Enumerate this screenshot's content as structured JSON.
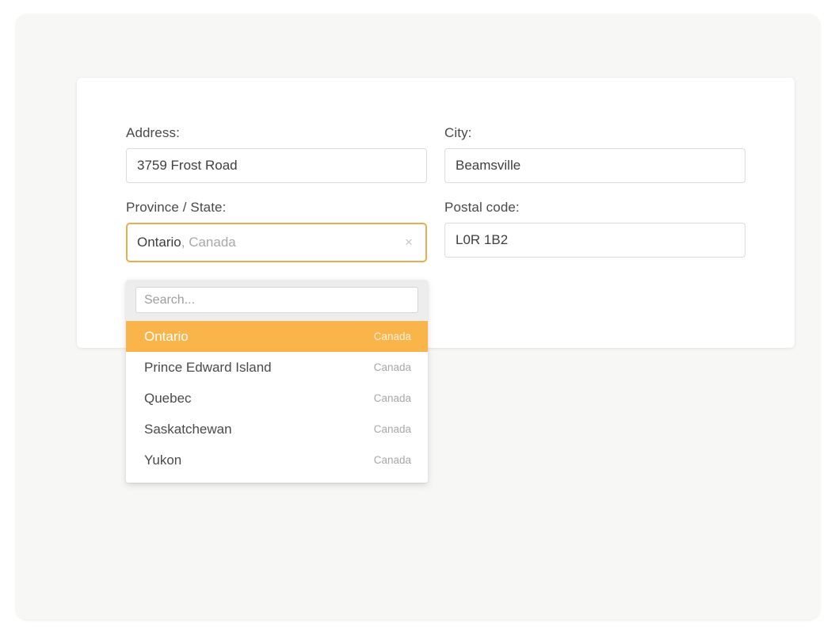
{
  "form": {
    "fields": [
      {
        "label": "Address:",
        "value": "3759 Frost Road",
        "name": "address"
      },
      {
        "label": "City:",
        "value": "Beamsville",
        "name": "city"
      },
      {
        "label": "Province / State:",
        "value_primary": "Ontario",
        "value_secondary": ", Canada",
        "name": "province-state"
      },
      {
        "label": "Postal code:",
        "value": "L0R 1B2",
        "name": "postal-code"
      }
    ]
  },
  "select": {
    "selected_region": "Ontario",
    "selected_country": ", Canada",
    "clear_glyph": "×",
    "focus_border_color": "#e8ad4e"
  },
  "dropdown": {
    "search_placeholder": "Search...",
    "search_value": "",
    "highlight_color": "#f9b44a",
    "options": [
      {
        "name": "Ontario",
        "country": "Canada",
        "highlighted": true
      },
      {
        "name": "Prince Edward Island",
        "country": "Canada",
        "highlighted": false
      },
      {
        "name": "Quebec",
        "country": "Canada",
        "highlighted": false
      },
      {
        "name": "Saskatchewan",
        "country": "Canada",
        "highlighted": false
      },
      {
        "name": "Yukon",
        "country": "Canada",
        "highlighted": false
      }
    ]
  },
  "theme": {
    "page_background": "#f7f7f5",
    "card_background": "#ffffff",
    "input_border": "#dcdcdc",
    "text_color": "#4a4a4a",
    "muted_text_color": "#a8a8a8"
  }
}
